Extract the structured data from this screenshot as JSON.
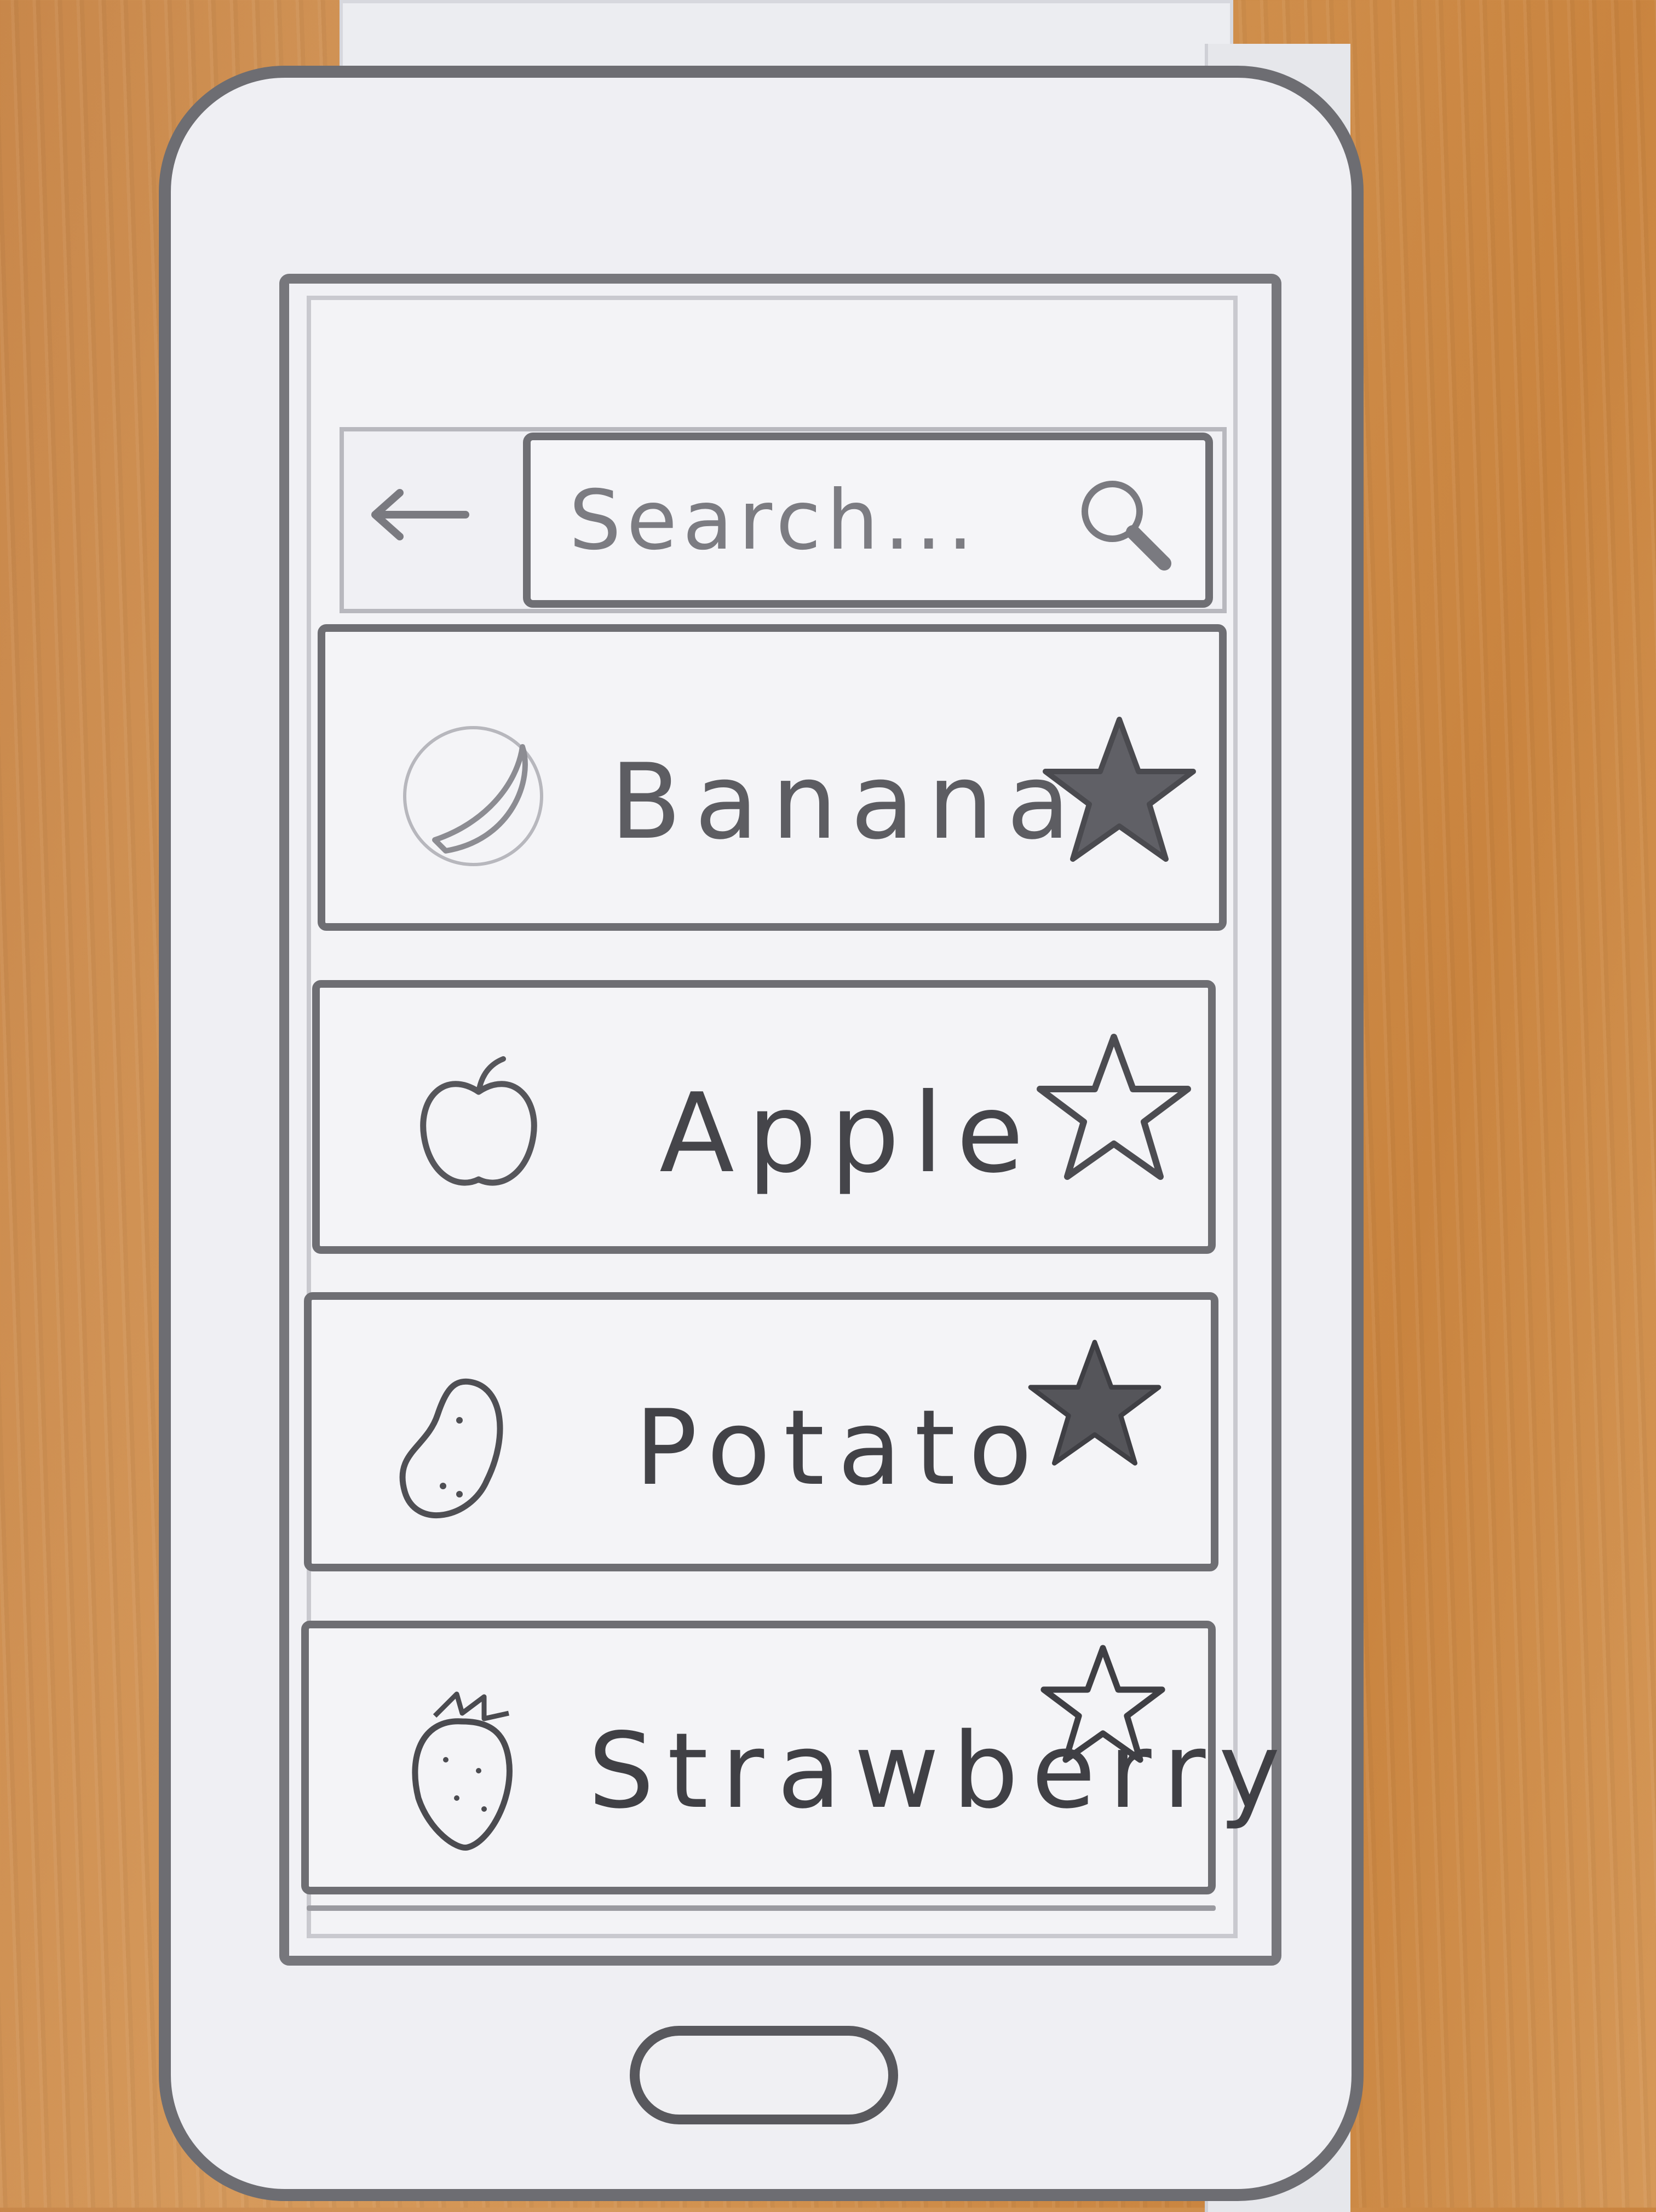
{
  "search": {
    "placeholder": "Search..."
  },
  "list": {
    "items": [
      {
        "label": "Banana",
        "icon": "banana-icon",
        "favorited": true
      },
      {
        "label": "Apple",
        "icon": "apple-icon",
        "favorited": false
      },
      {
        "label": "Potato",
        "icon": "potato-icon",
        "favorited": true
      },
      {
        "label": "Strawberry",
        "icon": "strawberry-icon",
        "favorited": false
      }
    ]
  },
  "icons": {
    "back": "arrow-left-icon",
    "search": "magnifier-icon",
    "home": "home-button"
  },
  "colors": {
    "pencil": "#6e6e73",
    "paper": "#f1f1f5",
    "table": "#d1914f"
  }
}
